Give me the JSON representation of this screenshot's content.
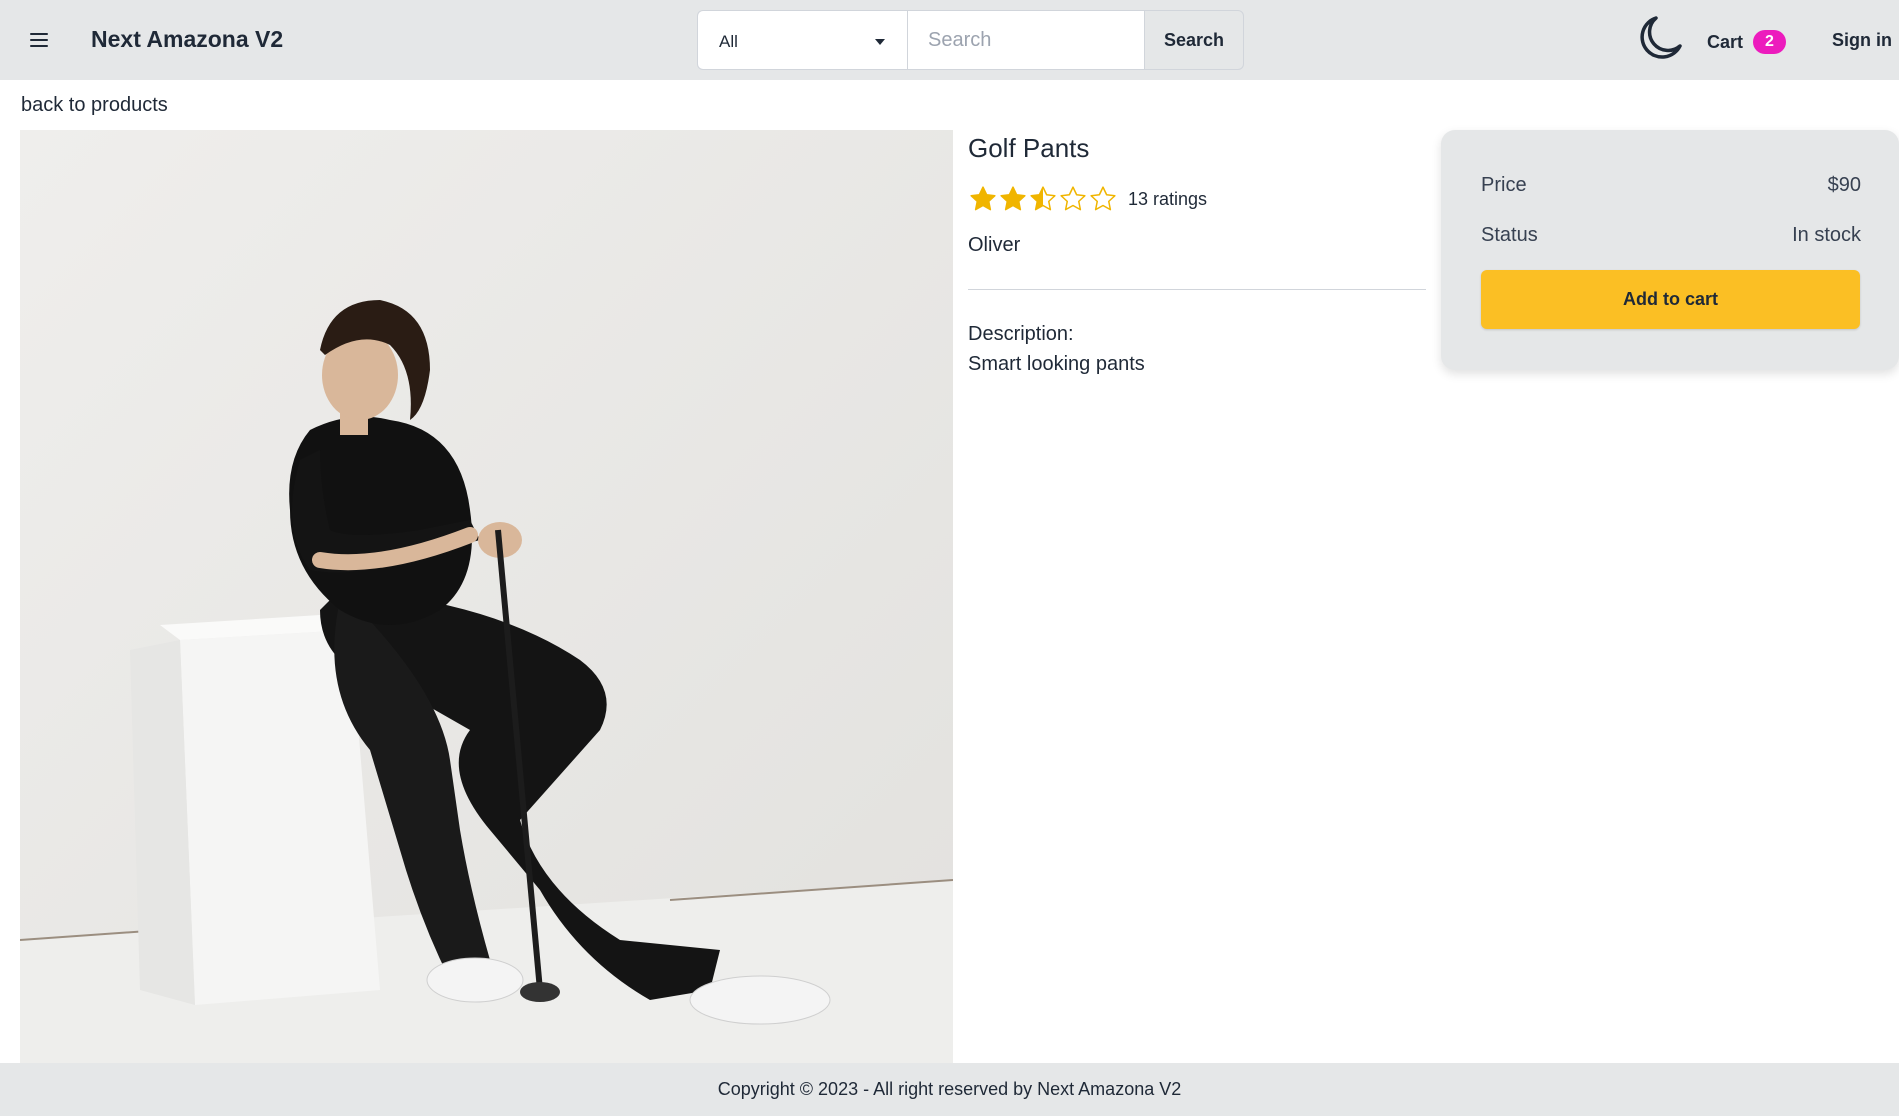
{
  "header": {
    "brand": "Next Amazona V2",
    "category_selected": "All",
    "search_placeholder": "Search",
    "search_button": "Search",
    "cart_label": "Cart",
    "cart_count": "2",
    "signin_label": "Sign in",
    "badge_color": "#ec1cbd"
  },
  "nav": {
    "back_link": "back to products"
  },
  "product": {
    "name": "Golf Pants",
    "rating": 2.5,
    "rating_max": 5,
    "ratings_label": "13 ratings",
    "brand": "Oliver",
    "description_label": "Description:",
    "description": "Smart looking pants",
    "image_icon": "product-photo"
  },
  "buy_box": {
    "price_label": "Price",
    "price_value": "$90",
    "status_label": "Status",
    "status_value": "In stock",
    "add_to_cart": "Add to cart",
    "button_color": "#fbbf24"
  },
  "footer": {
    "text": "Copyright © 2023 - All right reserved by Next Amazona V2"
  }
}
